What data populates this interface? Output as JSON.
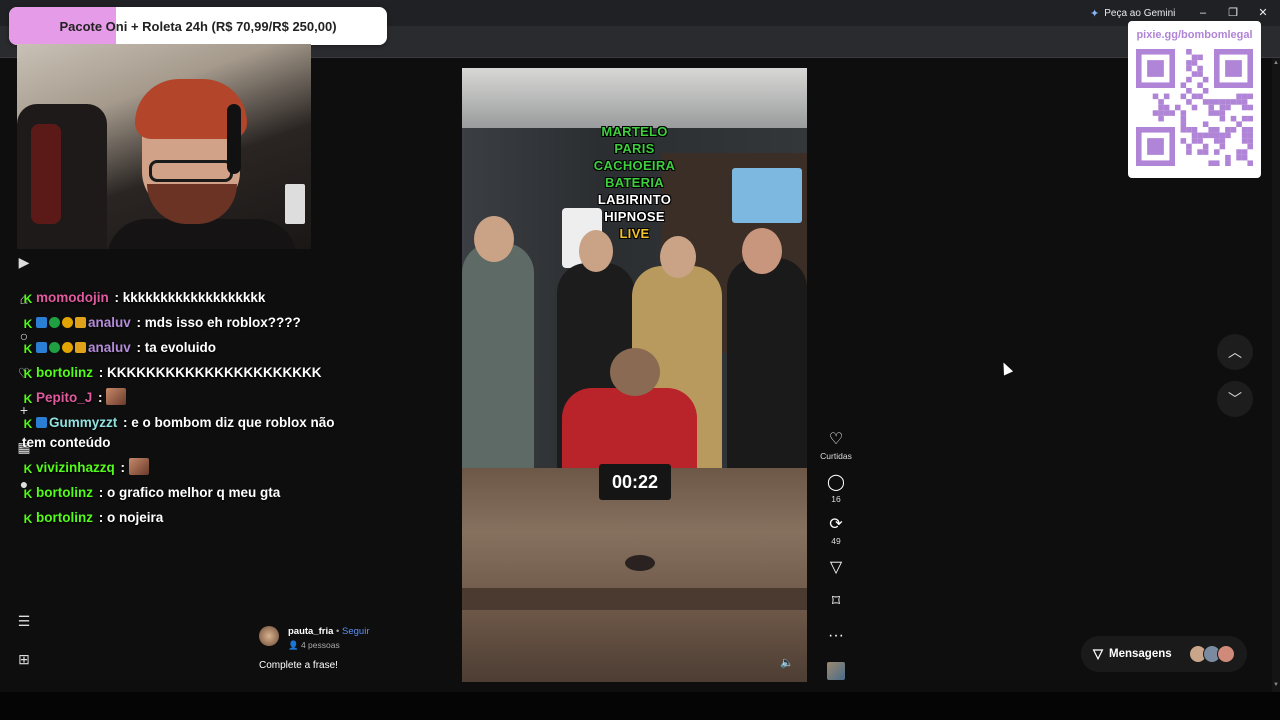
{
  "browser": {
    "gemini_label": "Peça ao Gemini",
    "window_controls": [
      "–",
      "❐",
      "✕"
    ]
  },
  "donation_bar": {
    "text": "Pacote Oni + Roleta 24h (R$ 70,99/R$ 250,00)",
    "progress": 0.284,
    "fill_color": "#e69be8"
  },
  "chat": {
    "messages": [
      {
        "badges": [
          "k"
        ],
        "user": "momodojin",
        "user_color": "#e05a9e",
        "text": " : kkkkkkkkkkkkkkkkkkk"
      },
      {
        "badges": [
          "k",
          "blue",
          "green",
          "gold",
          "crown"
        ],
        "user": "analuv",
        "user_color": "#b48cd9",
        "text": " : mds isso eh roblox????"
      },
      {
        "badges": [
          "k",
          "blue",
          "green",
          "gold",
          "crown"
        ],
        "user": "analuv",
        "user_color": "#b48cd9",
        "text": " : ta evoluido"
      },
      {
        "badges": [
          "k"
        ],
        "user": "bortolinz",
        "user_color": "#53fc18",
        "text": " : KKKKKKKKKKKKKKKKKKKKKK"
      },
      {
        "badges": [
          "k"
        ],
        "user": "Pepito_J",
        "user_color": "#e05a9e",
        "text": " : ",
        "emote": true
      },
      {
        "badges": [
          "k",
          "blue"
        ],
        "user": "Gummyzzt",
        "user_color": "#8fe0e0",
        "text": " : e o bombom diz que roblox não tem conteúdo"
      },
      {
        "badges": [
          "k"
        ],
        "user": "vivizinhazzq",
        "user_color": "#53fc18",
        "text": " : ",
        "emote": true
      },
      {
        "badges": [
          "k"
        ],
        "user": "bortolinz",
        "user_color": "#53fc18",
        "text": " : o grafico melhor q meu gta"
      },
      {
        "badges": [
          "k"
        ],
        "user": "bortolinz",
        "user_color": "#53fc18",
        "text": " : o nojeira"
      }
    ]
  },
  "video": {
    "overlay_words": [
      {
        "text": "MARTELO",
        "color": "#3ecf3e"
      },
      {
        "text": "PARIS",
        "color": "#3ecf3e"
      },
      {
        "text": "CACHOEIRA",
        "color": "#3ecf3e"
      },
      {
        "text": "BATERIA",
        "color": "#3ecf3e"
      },
      {
        "text": "LABIRINTO",
        "color": "#ffffff"
      },
      {
        "text": "HIPNOSE",
        "color": "#ffffff"
      },
      {
        "text": "LIVE",
        "color": "#f2c12e"
      }
    ],
    "timer": "00:22"
  },
  "actions": {
    "like_label": "Curtidas",
    "comments_count": "16",
    "reposts_count": "49"
  },
  "post": {
    "author": "pauta_fria",
    "separator": "•",
    "follow_label": "Seguir",
    "people_count": "4 pessoas",
    "caption": "Complete a frase!"
  },
  "qr": {
    "url": "pixie.gg/bombomlegal"
  },
  "messages": {
    "label": "Mensagens"
  }
}
